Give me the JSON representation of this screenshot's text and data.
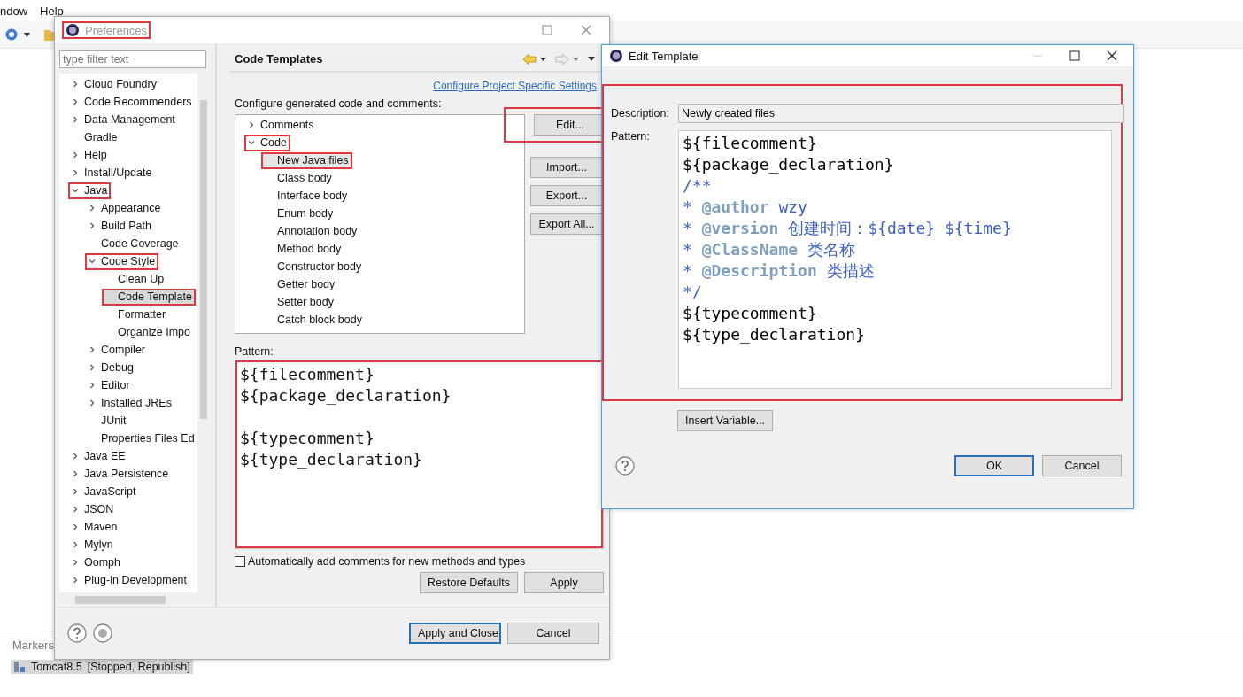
{
  "app": {
    "menu": [
      "ndow",
      "Help"
    ],
    "views": {
      "tab": "Markers",
      "server": {
        "label": "Tomcat8.5",
        "status": "[Stopped, Republish]",
        "selected": true
      }
    }
  },
  "preferences": {
    "title": "Preferences",
    "title_highlighted": true,
    "filter_placeholder": "type filter text",
    "tree": [
      {
        "label": "Cloud Foundry",
        "kind": "branch",
        "expanded": false,
        "selected": false,
        "highlighted": false
      },
      {
        "label": "Code Recommenders",
        "kind": "branch",
        "expanded": false,
        "selected": false,
        "highlighted": false
      },
      {
        "label": "Data Management",
        "kind": "branch",
        "expanded": false,
        "selected": false,
        "highlighted": false
      },
      {
        "label": "Gradle",
        "kind": "leaf",
        "selected": false,
        "highlighted": false
      },
      {
        "label": "Help",
        "kind": "branch",
        "expanded": false,
        "selected": false,
        "highlighted": false
      },
      {
        "label": "Install/Update",
        "kind": "branch",
        "expanded": false,
        "selected": false,
        "highlighted": false
      },
      {
        "label": "Java",
        "kind": "branch",
        "expanded": true,
        "selected": false,
        "highlighted": true,
        "children": [
          {
            "label": "Appearance",
            "kind": "branch",
            "expanded": false,
            "selected": false,
            "highlighted": false
          },
          {
            "label": "Build Path",
            "kind": "branch",
            "expanded": false,
            "selected": false,
            "highlighted": false
          },
          {
            "label": "Code Coverage",
            "kind": "leaf",
            "selected": false,
            "highlighted": false
          },
          {
            "label": "Code Style",
            "kind": "branch",
            "expanded": true,
            "selected": false,
            "highlighted": true,
            "children": [
              {
                "label": "Clean Up",
                "kind": "leaf",
                "selected": false,
                "highlighted": false
              },
              {
                "label": "Code Template",
                "kind": "leaf",
                "selected": true,
                "highlighted": true
              },
              {
                "label": "Formatter",
                "kind": "leaf",
                "selected": false,
                "highlighted": false
              },
              {
                "label": "Organize Impo",
                "kind": "leaf",
                "selected": false,
                "highlighted": false
              }
            ]
          },
          {
            "label": "Compiler",
            "kind": "branch",
            "expanded": false,
            "selected": false,
            "highlighted": false
          },
          {
            "label": "Debug",
            "kind": "branch",
            "expanded": false,
            "selected": false,
            "highlighted": false
          },
          {
            "label": "Editor",
            "kind": "branch",
            "expanded": false,
            "selected": false,
            "highlighted": false
          },
          {
            "label": "Installed JREs",
            "kind": "branch",
            "expanded": false,
            "selected": false,
            "highlighted": false
          },
          {
            "label": "JUnit",
            "kind": "leaf",
            "selected": false,
            "highlighted": false
          },
          {
            "label": "Properties Files Ed",
            "kind": "leaf",
            "selected": false,
            "highlighted": false
          }
        ]
      },
      {
        "label": "Java EE",
        "kind": "branch",
        "expanded": false,
        "selected": false,
        "highlighted": false
      },
      {
        "label": "Java Persistence",
        "kind": "branch",
        "expanded": false,
        "selected": false,
        "highlighted": false
      },
      {
        "label": "JavaScript",
        "kind": "branch",
        "expanded": false,
        "selected": false,
        "highlighted": false
      },
      {
        "label": "JSON",
        "kind": "branch",
        "expanded": false,
        "selected": false,
        "highlighted": false
      },
      {
        "label": "Maven",
        "kind": "branch",
        "expanded": false,
        "selected": false,
        "highlighted": false
      },
      {
        "label": "Mylyn",
        "kind": "branch",
        "expanded": false,
        "selected": false,
        "highlighted": false
      },
      {
        "label": "Oomph",
        "kind": "branch",
        "expanded": false,
        "selected": false,
        "highlighted": false
      },
      {
        "label": "Plug-in Development",
        "kind": "branch",
        "expanded": false,
        "selected": false,
        "highlighted": false
      }
    ],
    "page": {
      "heading": "Code Templates",
      "link": "Configure Project Specific Settings",
      "intro": "Configure generated code and comments:",
      "templates": [
        {
          "label": "Comments",
          "kind": "branch",
          "expanded": false,
          "selected": false,
          "highlighted": false
        },
        {
          "label": "Code",
          "kind": "branch",
          "expanded": true,
          "selected": false,
          "highlighted": true,
          "children": [
            {
              "label": "New Java files",
              "kind": "leaf",
              "selected": true,
              "highlighted": true
            },
            {
              "label": "Class body",
              "kind": "leaf",
              "selected": false,
              "highlighted": false
            },
            {
              "label": "Interface body",
              "kind": "leaf",
              "selected": false,
              "highlighted": false
            },
            {
              "label": "Enum body",
              "kind": "leaf",
              "selected": false,
              "highlighted": false
            },
            {
              "label": "Annotation body",
              "kind": "leaf",
              "selected": false,
              "highlighted": false
            },
            {
              "label": "Method body",
              "kind": "leaf",
              "selected": false,
              "highlighted": false
            },
            {
              "label": "Constructor body",
              "kind": "leaf",
              "selected": false,
              "highlighted": false
            },
            {
              "label": "Getter body",
              "kind": "leaf",
              "selected": false,
              "highlighted": false
            },
            {
              "label": "Setter body",
              "kind": "leaf",
              "selected": false,
              "highlighted": false
            },
            {
              "label": "Catch block body",
              "kind": "leaf",
              "selected": false,
              "highlighted": false
            }
          ]
        }
      ],
      "buttons": [
        {
          "label": "Edit...",
          "highlighted": true
        },
        {
          "label": "Import...",
          "highlighted": false
        },
        {
          "label": "Export...",
          "highlighted": false
        },
        {
          "label": "Export All...",
          "highlighted": false
        }
      ],
      "pattern_label": "Pattern:",
      "pattern": {
        "highlighted": true,
        "blocks": [
          [
            "${filecomment}",
            "${package_declaration}"
          ],
          [
            "${typecomment}",
            "${type_declaration}"
          ]
        ]
      },
      "auto_comments": {
        "label": "Automatically add comments for new methods and types",
        "checked": false
      },
      "page_buttons": [
        "Restore Defaults",
        "Apply"
      ]
    },
    "footer_buttons": [
      {
        "label": "Apply and Close",
        "default": true
      },
      {
        "label": "Cancel",
        "default": false
      }
    ]
  },
  "edit_template": {
    "title": "Edit Template",
    "form_highlighted": true,
    "description_label": "Description:",
    "description": "Newly created files",
    "pattern_label": "Pattern:",
    "pattern": [
      [
        {
          "text": "${filecomment}",
          "kind": "code"
        }
      ],
      [
        {
          "text": "${package_declaration}",
          "kind": "code"
        }
      ],
      [
        {
          "text": "/**",
          "kind": "comment"
        }
      ],
      [
        {
          "text": "* ",
          "kind": "comment"
        },
        {
          "text": "@author",
          "kind": "tag"
        },
        {
          "text": " wzy",
          "kind": "comment"
        }
      ],
      [
        {
          "text": "* ",
          "kind": "comment"
        },
        {
          "text": "@version",
          "kind": "tag"
        },
        {
          "text": " 创建时间：${date} ${time}",
          "kind": "comment"
        }
      ],
      [
        {
          "text": "* ",
          "kind": "comment"
        },
        {
          "text": "@ClassName",
          "kind": "tag"
        },
        {
          "text": " 类名称",
          "kind": "comment"
        }
      ],
      [
        {
          "text": "* ",
          "kind": "comment"
        },
        {
          "text": "@Description",
          "kind": "tag"
        },
        {
          "text": " 类描述",
          "kind": "comment"
        }
      ],
      [
        {
          "text": "*/",
          "kind": "comment"
        }
      ],
      [
        {
          "text": "${typecomment}",
          "kind": "code"
        }
      ],
      [
        {
          "text": "${type_declaration}",
          "kind": "code"
        }
      ]
    ],
    "insert_button": "Insert Variable...",
    "buttons": [
      {
        "label": "OK",
        "default": true
      },
      {
        "label": "Cancel",
        "default": false
      }
    ]
  }
}
